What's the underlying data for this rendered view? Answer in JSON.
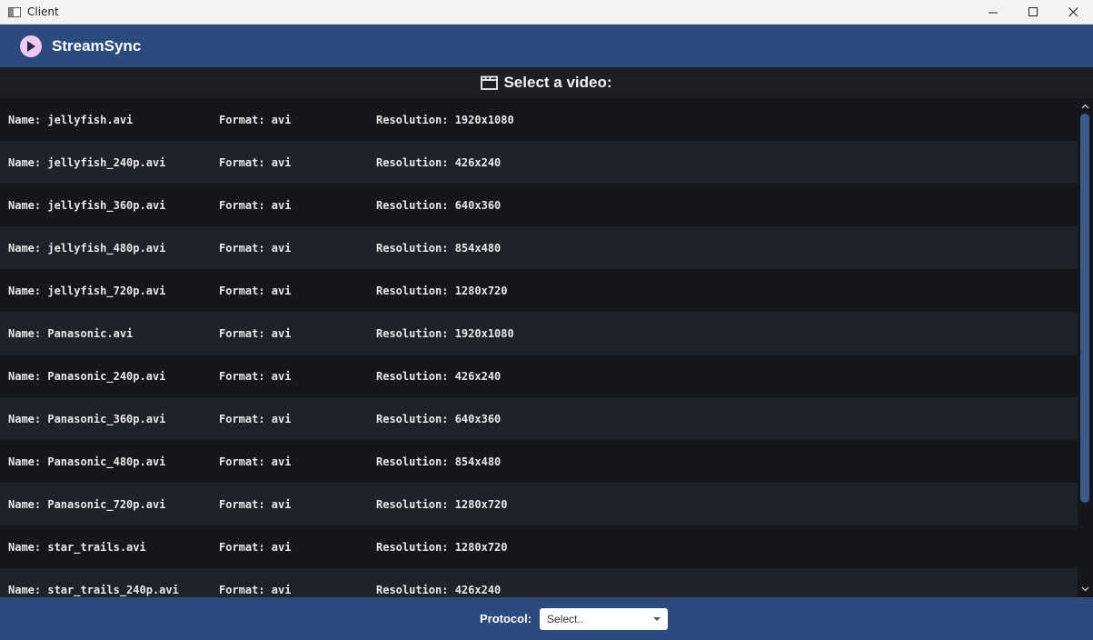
{
  "window": {
    "title": "Client"
  },
  "header": {
    "brand": "StreamSync"
  },
  "heading": {
    "text": "Select a video:"
  },
  "videos": [
    {
      "name": "Name: jellyfish.avi",
      "format": "Format: avi",
      "resolution": "Resolution: 1920x1080"
    },
    {
      "name": "Name: jellyfish_240p.avi",
      "format": "Format: avi",
      "resolution": "Resolution: 426x240"
    },
    {
      "name": "Name: jellyfish_360p.avi",
      "format": "Format: avi",
      "resolution": "Resolution: 640x360"
    },
    {
      "name": "Name: jellyfish_480p.avi",
      "format": "Format: avi",
      "resolution": "Resolution: 854x480"
    },
    {
      "name": "Name: jellyfish_720p.avi",
      "format": "Format: avi",
      "resolution": "Resolution: 1280x720"
    },
    {
      "name": "Name: Panasonic.avi",
      "format": "Format: avi",
      "resolution": "Resolution: 1920x1080"
    },
    {
      "name": "Name: Panasonic_240p.avi",
      "format": "Format: avi",
      "resolution": "Resolution: 426x240"
    },
    {
      "name": "Name: Panasonic_360p.avi",
      "format": "Format: avi",
      "resolution": "Resolution: 640x360"
    },
    {
      "name": "Name: Panasonic_480p.avi",
      "format": "Format: avi",
      "resolution": "Resolution: 854x480"
    },
    {
      "name": "Name: Panasonic_720p.avi",
      "format": "Format: avi",
      "resolution": "Resolution: 1280x720"
    },
    {
      "name": "Name: star_trails.avi",
      "format": "Format: avi",
      "resolution": "Resolution: 1280x720"
    },
    {
      "name": "Name: star_trails_240p.avi",
      "format": "Format: avi",
      "resolution": "Resolution: 426x240"
    }
  ],
  "footer": {
    "protocol_label": "Protocol:",
    "protocol_selected": "Select.."
  },
  "colors": {
    "header_bg": "#2b4a7d",
    "list_bg": "#15171b",
    "row_alt_bg": "#1f2228",
    "scroll_thumb": "#3a5a8c",
    "logo_bg": "#f0c9f0"
  },
  "icons": {
    "app": "window-app-icon",
    "logo": "play-circle-icon",
    "heading": "clapperboard-icon",
    "minimize": "minimize-icon",
    "maximize": "maximize-icon",
    "close": "close-icon"
  }
}
